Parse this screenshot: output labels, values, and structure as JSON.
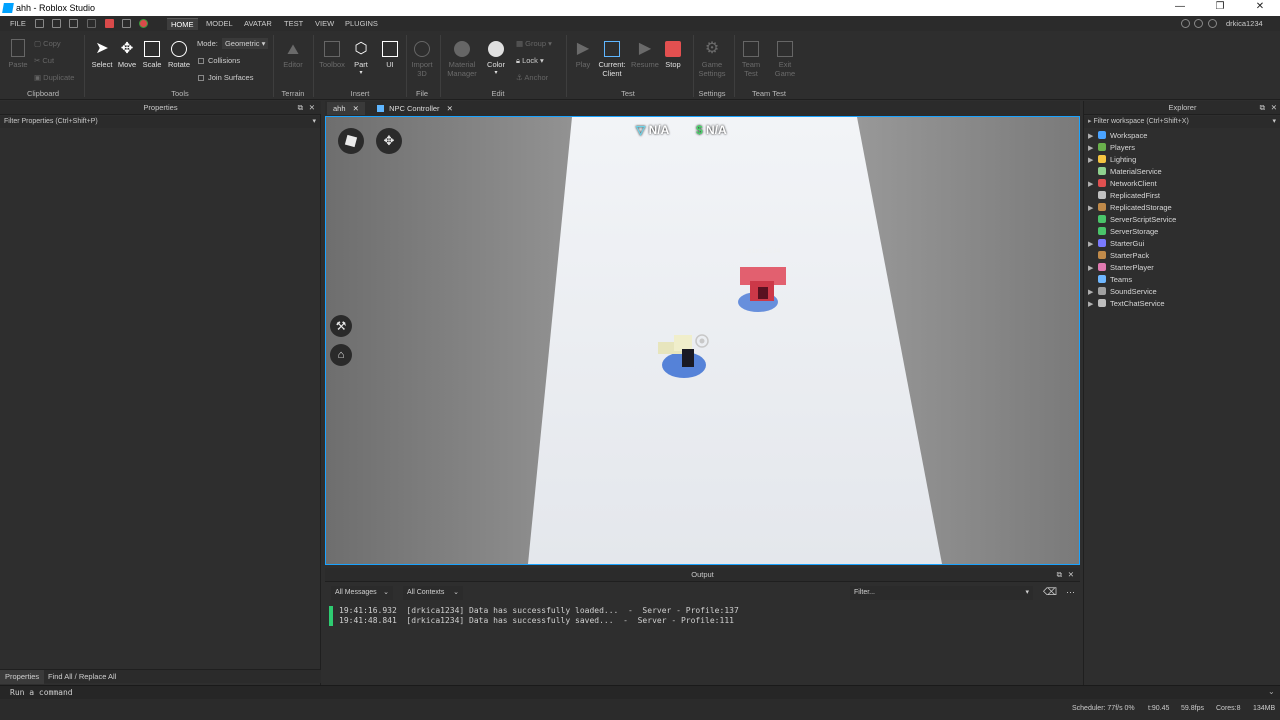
{
  "window": {
    "title": "ahh - Roblox Studio"
  },
  "menubar": {
    "file": "FILE",
    "tabs": [
      "HOME",
      "MODEL",
      "AVATAR",
      "TEST",
      "VIEW",
      "PLUGINS"
    ],
    "user": "drkica1234"
  },
  "ribbon": {
    "clipboard": {
      "paste": "Paste",
      "copy": "Copy",
      "cut": "Cut",
      "duplicate": "Duplicate",
      "label": "Clipboard"
    },
    "tools": {
      "select": "Select",
      "move": "Move",
      "scale": "Scale",
      "rotate": "Rotate",
      "mode_label": "Mode:",
      "mode_value": "Geometric",
      "collisions": "Collisions",
      "join_surfaces": "Join Surfaces",
      "label": "Tools"
    },
    "terrain": {
      "editor": "Editor",
      "label": "Terrain"
    },
    "insert": {
      "toolbox": "Toolbox",
      "part": "Part",
      "ui": "UI",
      "label": "Insert"
    },
    "file": {
      "import3d": "Import 3D",
      "label": "File"
    },
    "edit": {
      "material_manager": "Material Manager",
      "color": "Color",
      "group": "Group",
      "lock": "Lock",
      "anchor": "Anchor",
      "label": "Edit"
    },
    "test": {
      "play": "Play",
      "current_client": "Current: Client",
      "resume": "Resume",
      "stop": "Stop",
      "label": "Test"
    },
    "settings": {
      "game_settings": "Game Settings",
      "label": "Settings"
    },
    "team_test": {
      "team_test": "Team Test",
      "exit_game": "Exit Game",
      "label": "Team Test"
    }
  },
  "properties": {
    "title": "Properties",
    "filter_placeholder": "Filter Properties (Ctrl+Shift+P)",
    "bottom_tabs": [
      "Properties",
      "Find All / Replace All"
    ]
  },
  "doc_tabs": [
    "ahh",
    "NPC Controller"
  ],
  "viewport": {
    "hud_left": "N/A",
    "hud_right": "N/A",
    "player_name": "drkica1234"
  },
  "explorer": {
    "title": "Explorer",
    "filter_placeholder": "Filter workspace (Ctrl+Shift+X)",
    "items": [
      {
        "label": "Workspace",
        "expandable": true,
        "color": "#4aa3ff"
      },
      {
        "label": "Players",
        "expandable": true,
        "color": "#6ab04c"
      },
      {
        "label": "Lighting",
        "expandable": true,
        "color": "#f5c542"
      },
      {
        "label": "MaterialService",
        "expandable": false,
        "color": "#8fd18f"
      },
      {
        "label": "NetworkClient",
        "expandable": true,
        "color": "#e05050"
      },
      {
        "label": "ReplicatedFirst",
        "expandable": false,
        "color": "#c0c0c0"
      },
      {
        "label": "ReplicatedStorage",
        "expandable": true,
        "color": "#c08a4a"
      },
      {
        "label": "ServerScriptService",
        "expandable": false,
        "color": "#4ac46a"
      },
      {
        "label": "ServerStorage",
        "expandable": false,
        "color": "#4ac46a"
      },
      {
        "label": "StarterGui",
        "expandable": true,
        "color": "#7a7aff"
      },
      {
        "label": "StarterPack",
        "expandable": false,
        "color": "#c08a4a"
      },
      {
        "label": "StarterPlayer",
        "expandable": true,
        "color": "#e07ab0"
      },
      {
        "label": "Teams",
        "expandable": false,
        "color": "#6fb7ff"
      },
      {
        "label": "SoundService",
        "expandable": true,
        "color": "#a0a0a0"
      },
      {
        "label": "TextChatService",
        "expandable": true,
        "color": "#bdbdbd"
      }
    ]
  },
  "output": {
    "title": "Output",
    "messages_filter": "All Messages",
    "contexts_filter": "All Contexts",
    "filter_placeholder": "Filter...",
    "lines": [
      "19:41:16.932  [drkica1234] Data has successfully loaded...  -  Server - Profile:137",
      "19:41:48.841  [drkica1234] Data has successfully saved...  -  Server - Profile:111"
    ]
  },
  "command_bar": {
    "placeholder": "Run a command"
  },
  "status": {
    "scheduler": "Scheduler: 77f/s 0%",
    "t": "t:90.45",
    "fps": "59.8fps",
    "cores": "Cores:8",
    "memory": "134MB"
  }
}
